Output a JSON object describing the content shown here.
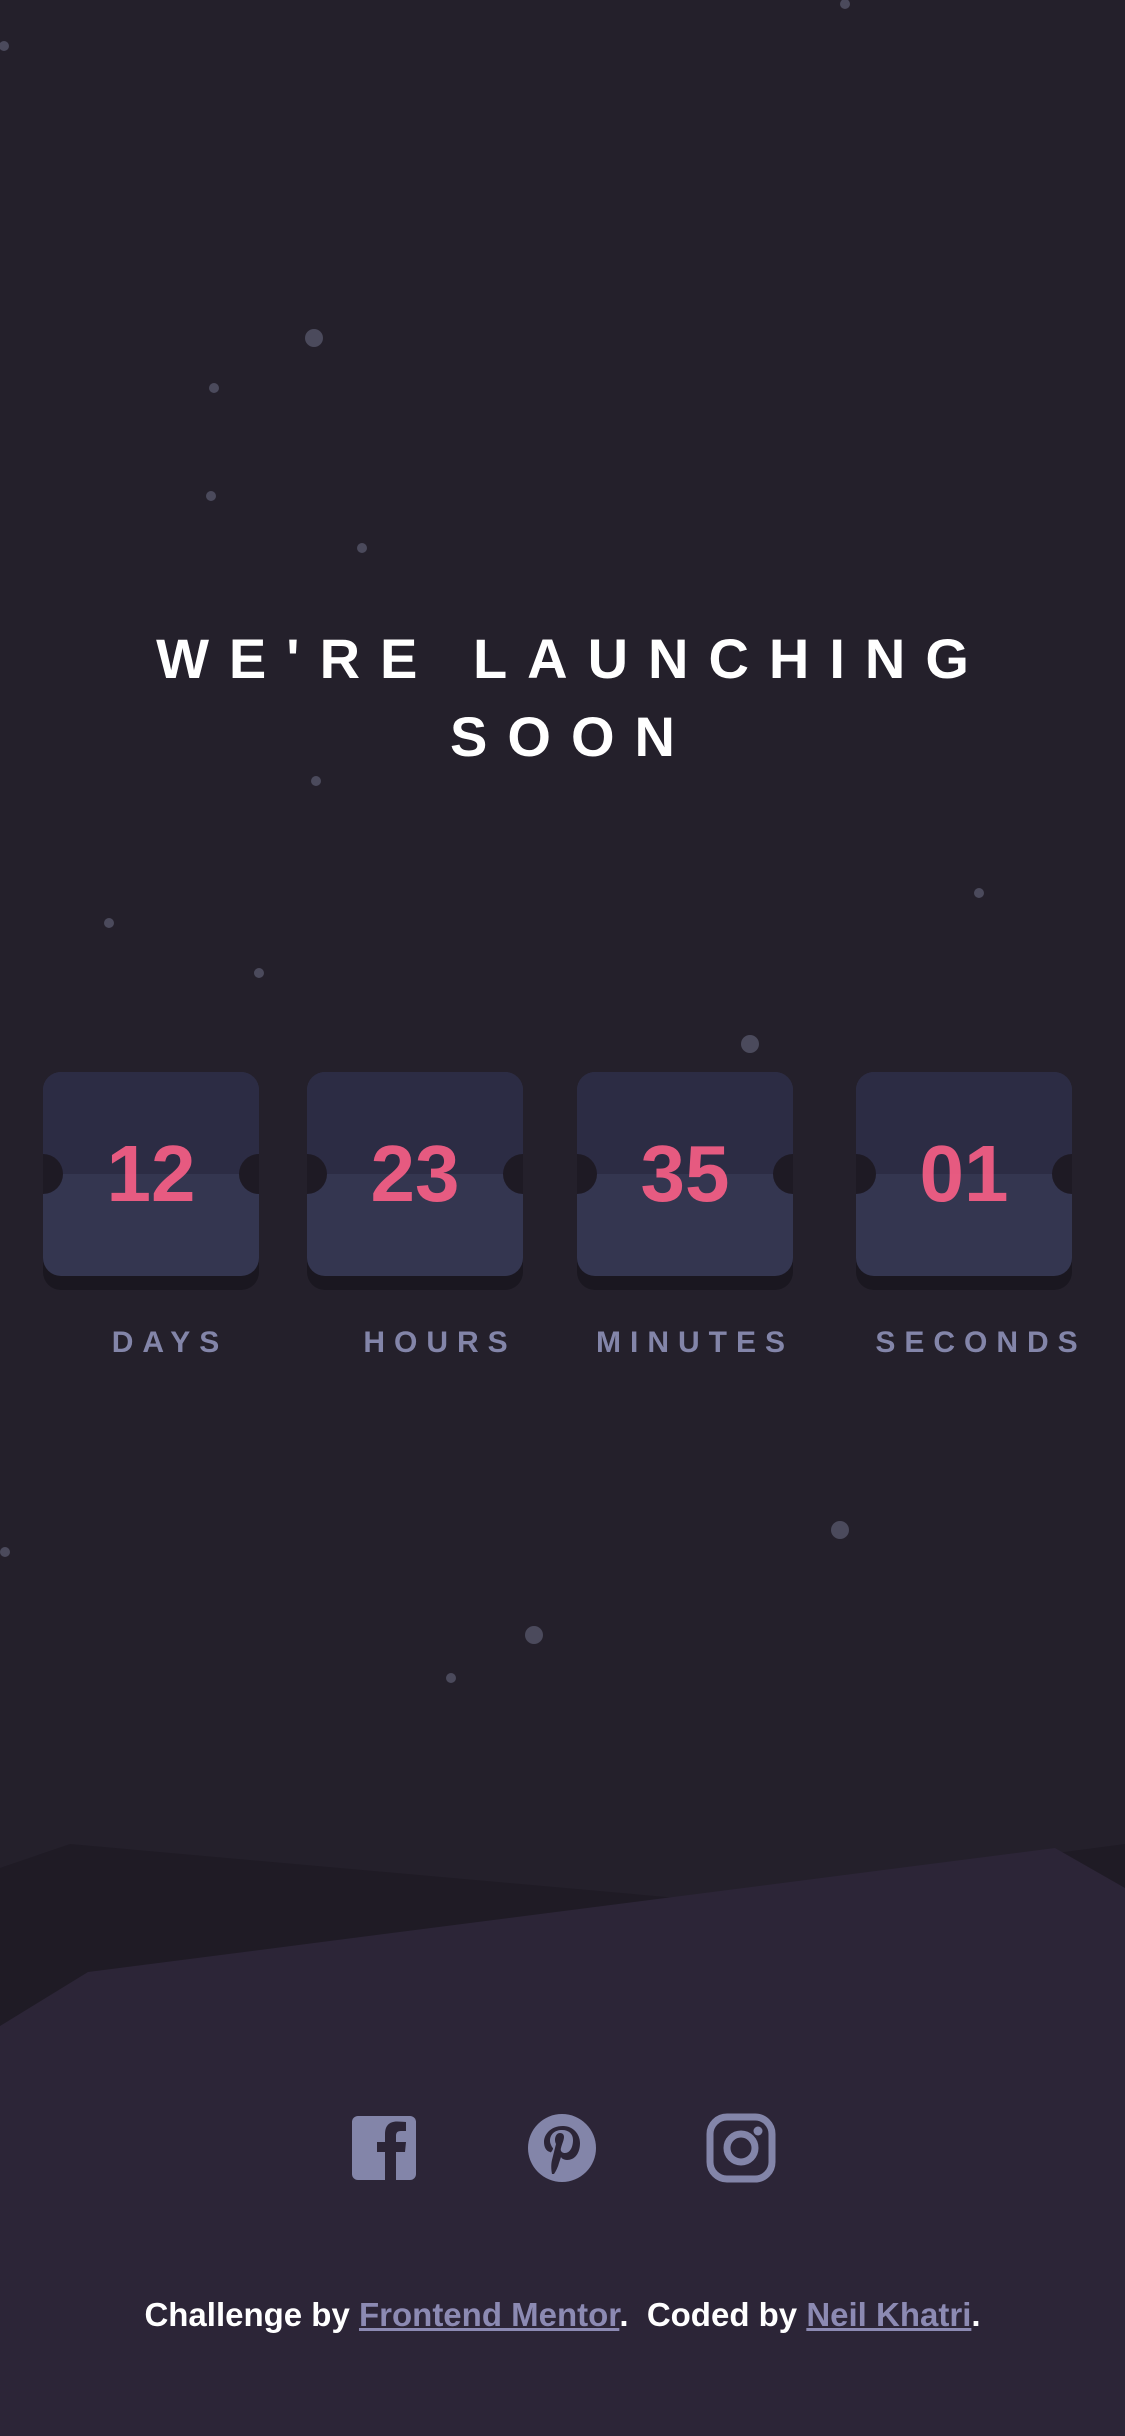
{
  "page": {
    "headline": "WE'RE LAUNCHING SOON"
  },
  "countdown": [
    {
      "value": "12",
      "unit": "DAYS"
    },
    {
      "value": "23",
      "unit": "HOURS"
    },
    {
      "value": "35",
      "unit": "MINUTES"
    },
    {
      "value": "01",
      "unit": "SECONDS"
    }
  ],
  "socials": [
    {
      "name": "facebook-icon"
    },
    {
      "name": "pinterest-icon"
    },
    {
      "name": "instagram-icon"
    }
  ],
  "footer": {
    "prefix": "Challenge by ",
    "link1": "Frontend Mentor",
    "middle": ".  Coded by ",
    "link2": "Neil Khatri",
    "suffix": "."
  },
  "colors": {
    "background": "#24202b",
    "accent": "#fb6087",
    "card": "#343650",
    "muted": "#8385a9"
  }
}
